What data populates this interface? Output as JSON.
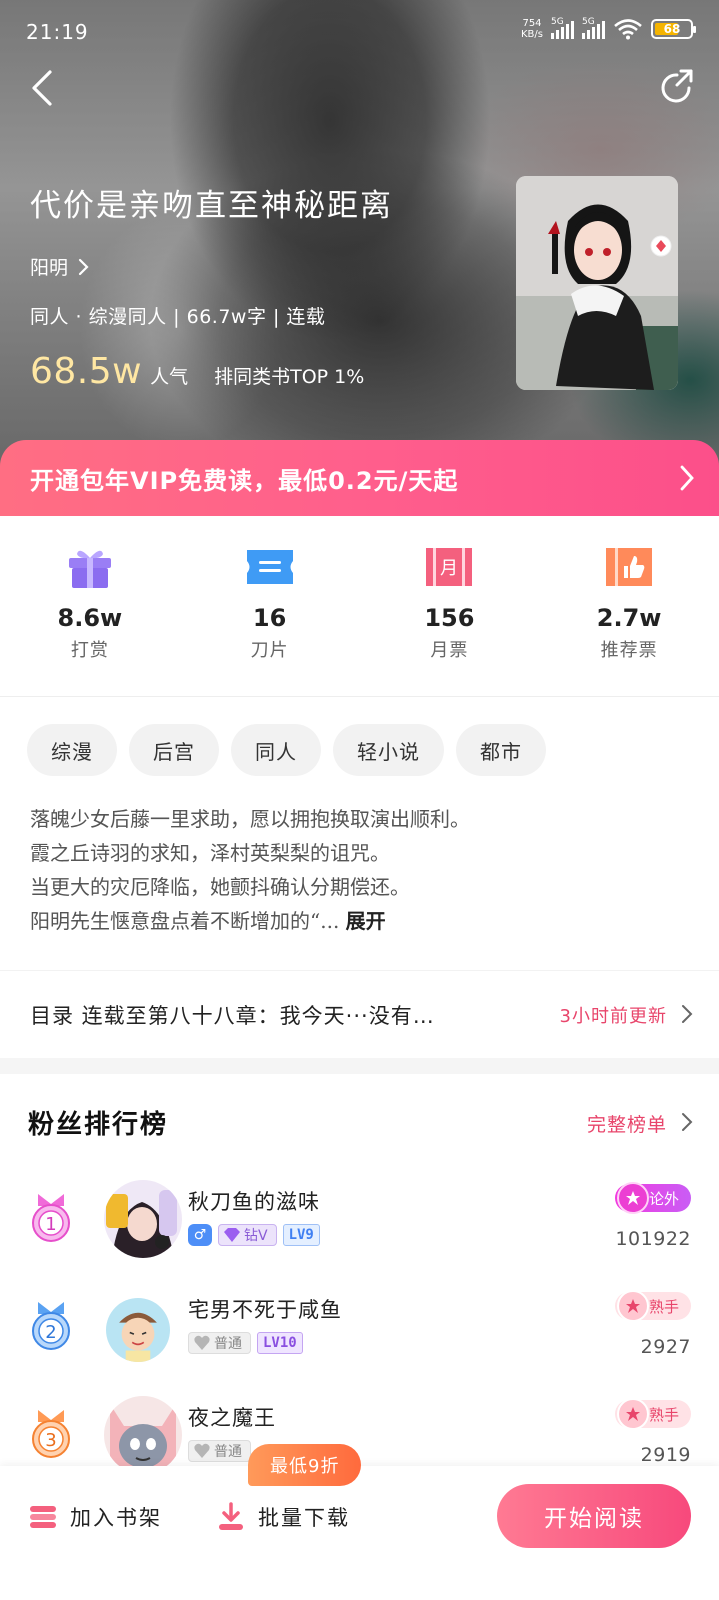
{
  "status_bar": {
    "time": "21:19",
    "net_speed_value": "754",
    "net_speed_unit": "KB/s",
    "sim1": "5G",
    "sim2": "5G",
    "battery": "68"
  },
  "book": {
    "title": "代价是亲吻直至神秘距离",
    "author": "阳明",
    "meta": "同人 · 综漫同人 | 66.7w字 | 连载",
    "popularity_value": "68.5w",
    "popularity_label": "人气",
    "rank_text": "排同类书TOP 1%"
  },
  "vip_banner": {
    "text": "开通包年VIP免费读，最低0.2元/天起"
  },
  "stats": [
    {
      "value": "8.6w",
      "label": "打赏",
      "icon": "gift-icon",
      "color": "#8b6cf0"
    },
    {
      "value": "16",
      "label": "刀片",
      "icon": "ticket-icon",
      "color": "#3f9bf5"
    },
    {
      "value": "156",
      "label": "月票",
      "icon": "month-ticket-icon",
      "color": "#f4607e"
    },
    {
      "value": "2.7w",
      "label": "推荐票",
      "icon": "thumbs-up-ticket-icon",
      "color": "#ff8a5a"
    }
  ],
  "tags": [
    "综漫",
    "后宫",
    "同人",
    "轻小说",
    "都市"
  ],
  "description": {
    "lines": [
      "落魄少女后藤一里求助，愿以拥抱换取演出顺利。",
      "霞之丘诗羽的求知，泽村英梨梨的诅咒。",
      "当更大的灾厄降临，她颤抖确认分期偿还。",
      "阳明先生惬意盘点着不断增加的“..."
    ],
    "expand": "展开"
  },
  "toc": {
    "text": "目录  连载至第八十八章：我今天···没有…",
    "updated": "3小时前更新"
  },
  "fans": {
    "title": "粉丝排行榜",
    "full_list": "完整榜单",
    "entries": [
      {
        "rank": "1",
        "name": "秋刀鱼的滋味",
        "gender": "♂",
        "vip": "钻V",
        "level": "LV9",
        "badge": "论外",
        "score": "101922"
      },
      {
        "rank": "2",
        "name": "宅男不死于咸鱼",
        "vip": "普通",
        "level": "LV10",
        "badge": "熟手",
        "score": "2927"
      },
      {
        "rank": "3",
        "name": "夜之魔王",
        "vip": "普通",
        "badge": "熟手",
        "score": "2919"
      }
    ]
  },
  "bottom_bar": {
    "shelf": "加入书架",
    "download": "批量下载",
    "discount": "最低9折",
    "start": "开始阅读"
  }
}
